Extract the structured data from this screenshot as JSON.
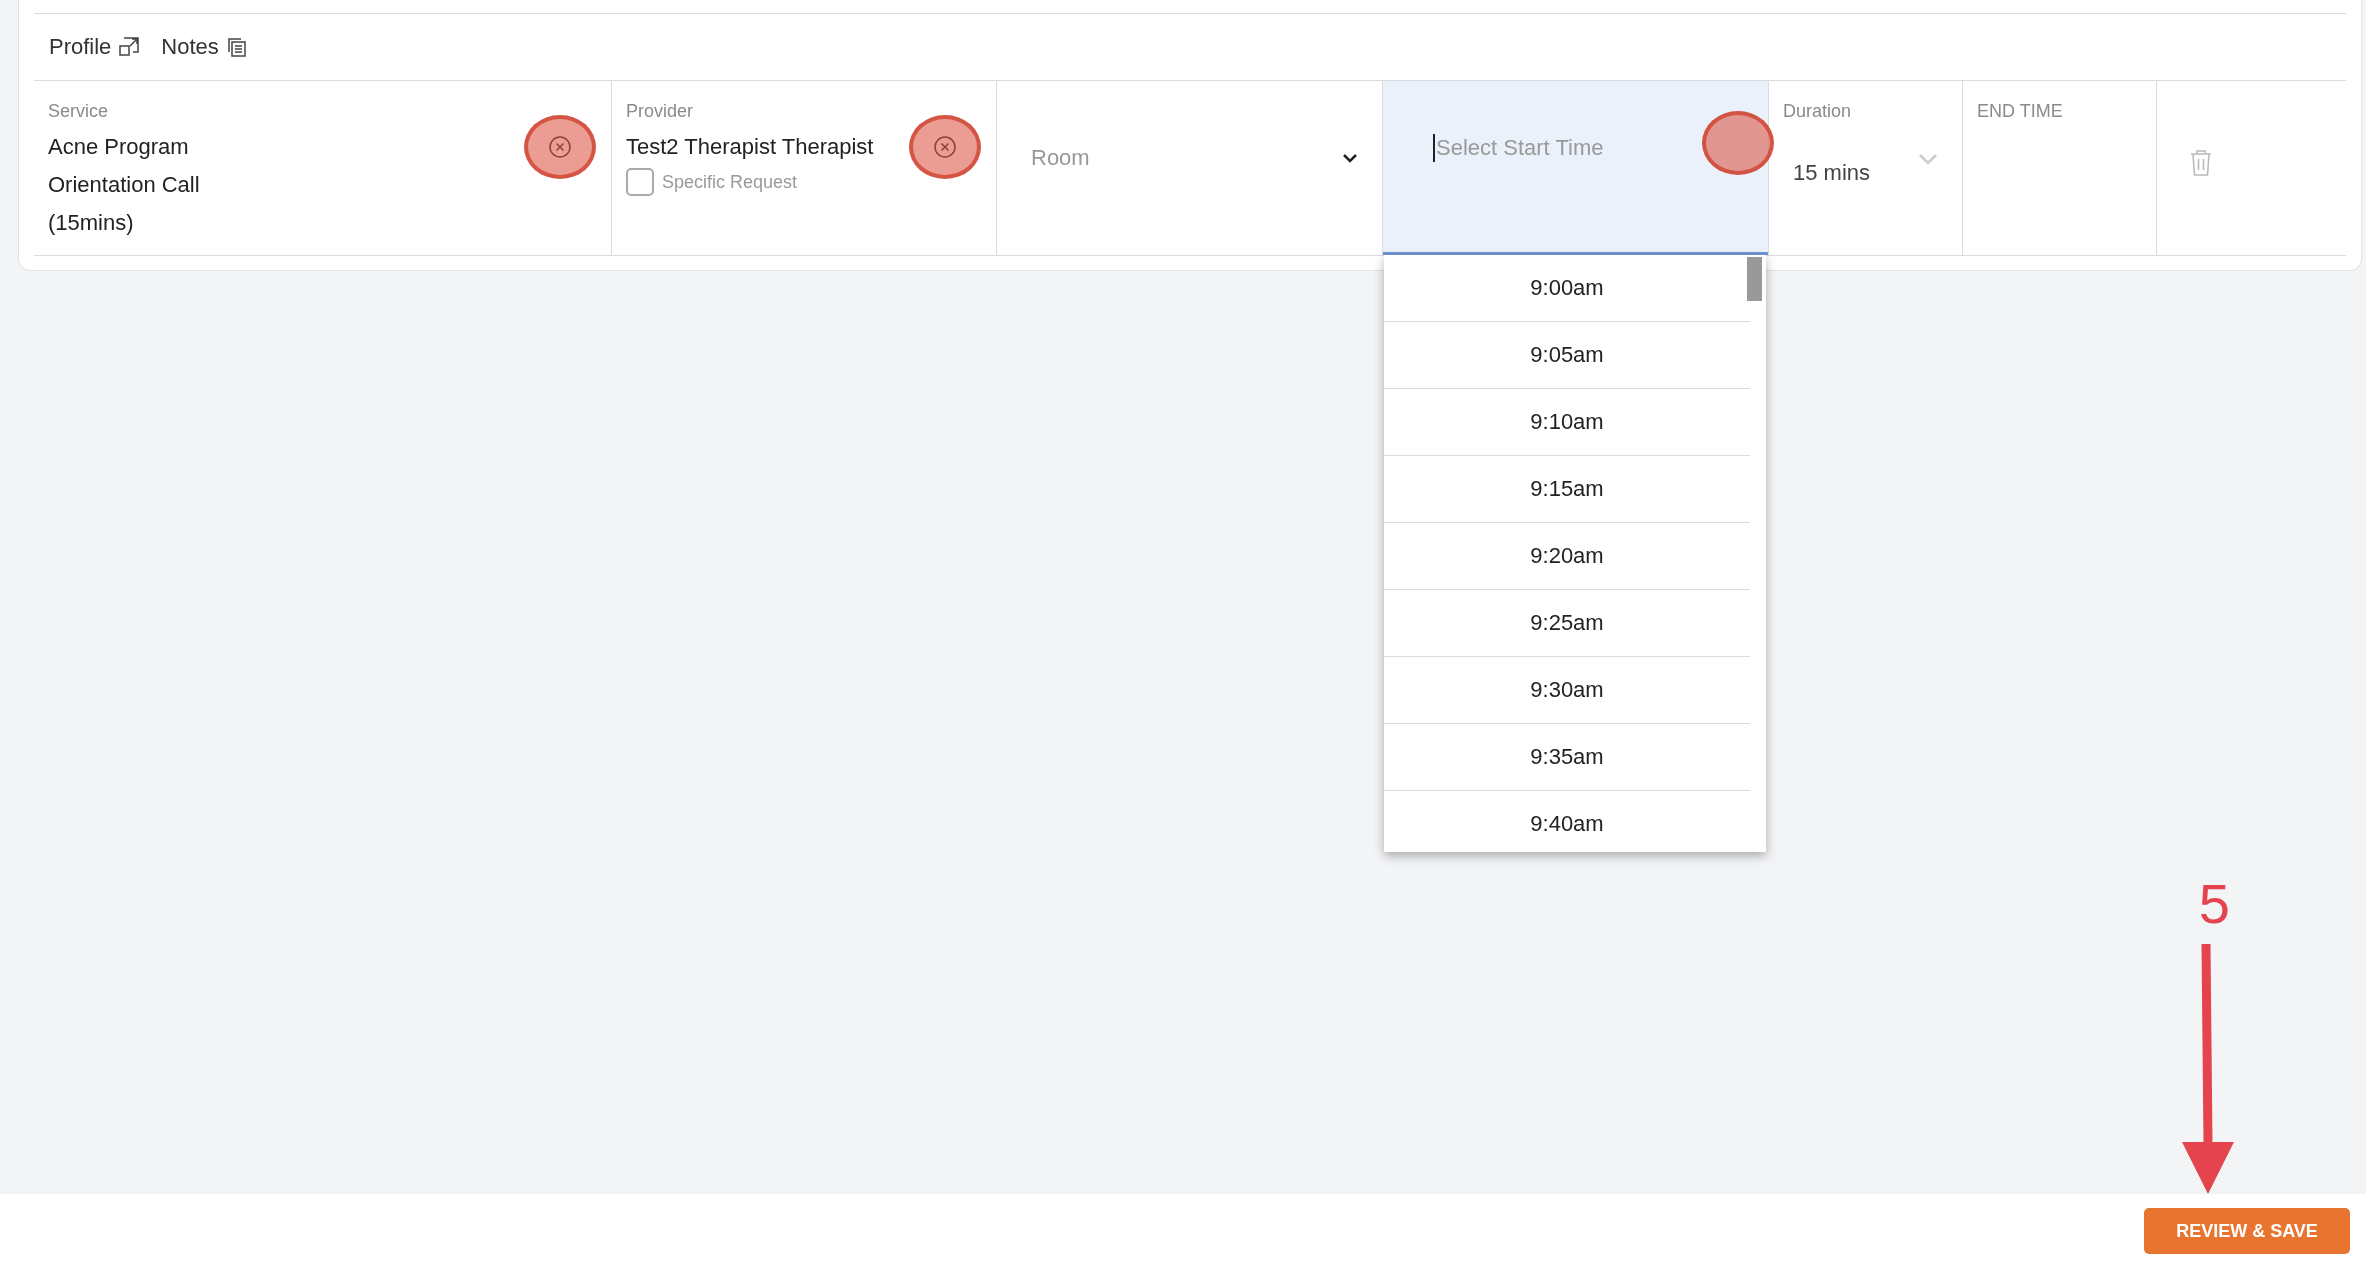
{
  "toolbar": {
    "links": [
      {
        "label": "Profile",
        "kind": "profile"
      },
      {
        "label": "Notes",
        "kind": "notes"
      }
    ]
  },
  "service": {
    "label": "Service",
    "lines": [
      "Acne Program",
      "Orientation Call",
      "(15mins)"
    ]
  },
  "provider": {
    "label": "Provider",
    "value": "Test2 Therapist Therapist",
    "specific_request": {
      "label": "Specific Request",
      "checked": false
    }
  },
  "room": {
    "placeholder": "Room"
  },
  "start_time": {
    "placeholder": "Select Start Time",
    "focused": true,
    "expanded": true,
    "options": [
      "9:00am",
      "9:05am",
      "9:10am",
      "9:15am",
      "9:20am",
      "9:25am",
      "9:30am",
      "9:35am",
      "9:40am"
    ]
  },
  "duration": {
    "label": "Duration",
    "value": "15 mins"
  },
  "end_time": {
    "label": "END TIME"
  },
  "annotation": {
    "step": "5"
  },
  "footer": {
    "button": "REVIEW & SAVE"
  }
}
